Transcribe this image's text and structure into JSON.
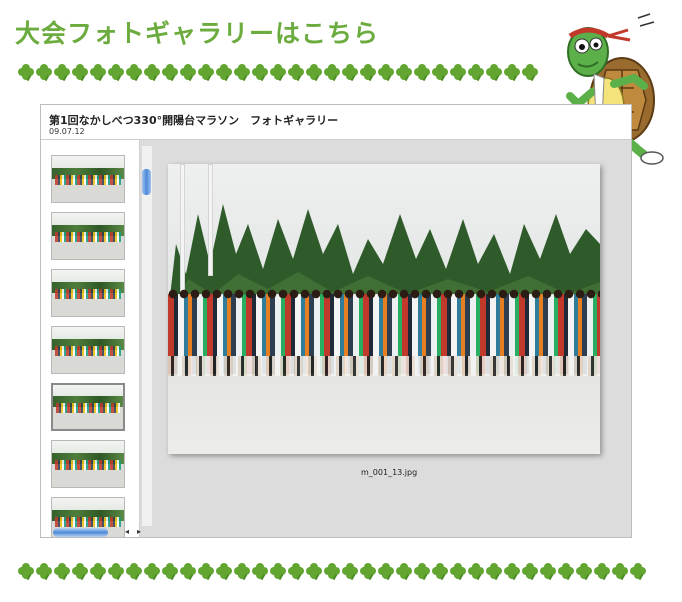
{
  "page": {
    "heading": "大会フォトギャラリーはこちら"
  },
  "gallery": {
    "title": "第1回なかしべつ330°開陽台マラソン　フォトギャラリー",
    "date": "09.07.12",
    "thumbnails": [
      {
        "name": "thumb-1"
      },
      {
        "name": "thumb-2"
      },
      {
        "name": "thumb-3"
      },
      {
        "name": "thumb-4"
      },
      {
        "name": "thumb-5",
        "selected": true
      },
      {
        "name": "thumb-6"
      },
      {
        "name": "thumb-7"
      }
    ],
    "scroll_arrows": {
      "left": "◂",
      "right": "▸"
    },
    "photo": {
      "caption": "m_001_13.jpg"
    }
  },
  "colors": {
    "heading_green": "#6cab3e",
    "clover_green": "#62a531",
    "selection_blue": "#4e8ad9",
    "frame_gray": "#dcdcdc"
  },
  "icons": [
    "clover-icon",
    "mascot-turtle-runner"
  ]
}
